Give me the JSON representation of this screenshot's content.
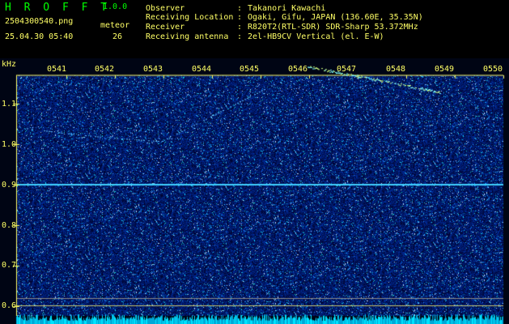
{
  "app": {
    "title": "H R O F F T",
    "version": "1.0.0"
  },
  "file": {
    "name": "2504300540.png",
    "datetime": "25.04.30 05:40"
  },
  "meteor": {
    "label": "meteor",
    "count": "26"
  },
  "info": [
    {
      "key": "Observer",
      "sep": ":",
      "value": "Takanori Kawachi"
    },
    {
      "key": "Receiving Location",
      "sep": ":",
      "value": "Ogaki, Gifu, JAPAN (136.60E, 35.35N)"
    },
    {
      "key": "Receiver",
      "sep": ":",
      "value": "R820T2(RTL-SDR) SDR-Sharp 53.372MHz"
    },
    {
      "key": "Receiving antenna",
      "sep": ":",
      "value": "2el-HB9CV Vertical (el. E-W)"
    }
  ],
  "axis": {
    "unit": "kHz",
    "freq_ticks": [
      "1.1",
      "1.0",
      "0.9",
      "0.8",
      "0.7",
      "0.6"
    ],
    "time_ticks": [
      "0541",
      "0542",
      "0543",
      "0544",
      "0545",
      "0546",
      "0547",
      "0548",
      "0549",
      "0550"
    ]
  },
  "colors": {
    "background": "#000000",
    "noise_dark": "#000a3a",
    "noise_mid": "#1030b0",
    "signal": "#40d0ff",
    "title_green": "#00ff00",
    "label_yellow": "#ffff66",
    "cyan_bottom": "#00e5ff"
  }
}
